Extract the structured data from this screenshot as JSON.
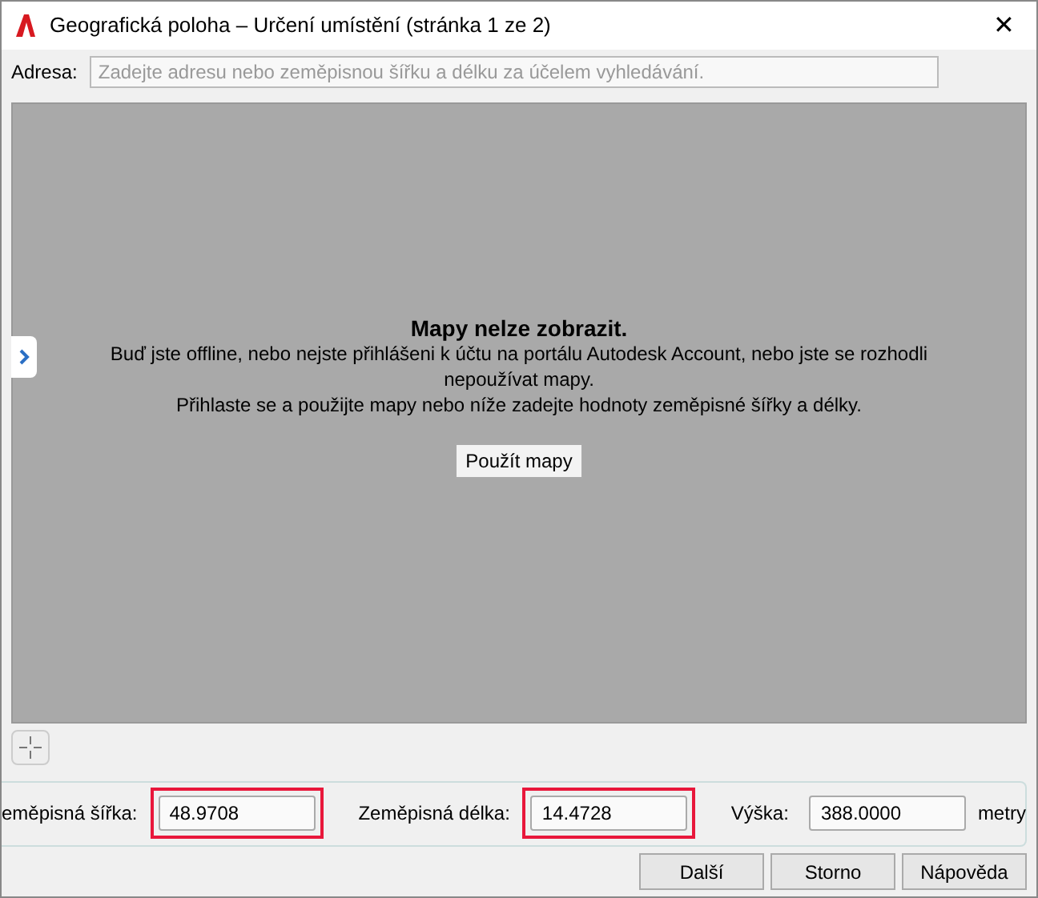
{
  "window": {
    "title": "Geografická poloha – Určení umístění (stránka 1 ze 2)",
    "close": "✕"
  },
  "address": {
    "label": "Adresa:",
    "placeholder": "Zadejte adresu nebo zeměpisnou šířku a délku za účelem vyhledávání."
  },
  "map": {
    "heading": "Mapy nelze zobrazit.",
    "message": "Buď jste offline, nebo nejste přihlášeni k účtu na portálu Autodesk Account, nebo jste se rozhodli nepoužívat mapy.",
    "hint": "Přihlaste se a použijte mapy nebo níže zadejte hodnoty zeměpisné šířky a délky.",
    "button": "Použít mapy"
  },
  "coordinates": [
    {
      "label": "eměpisná šířka:",
      "value": "48.9708",
      "highlighted": true
    },
    {
      "label": "Zeměpisná délka:",
      "value": "14.4728",
      "highlighted": true
    },
    {
      "label": "Výška:",
      "value": "388.0000",
      "highlighted": false,
      "unit": "metry"
    }
  ],
  "buttons": [
    "Další",
    "Storno",
    "Nápověda"
  ]
}
